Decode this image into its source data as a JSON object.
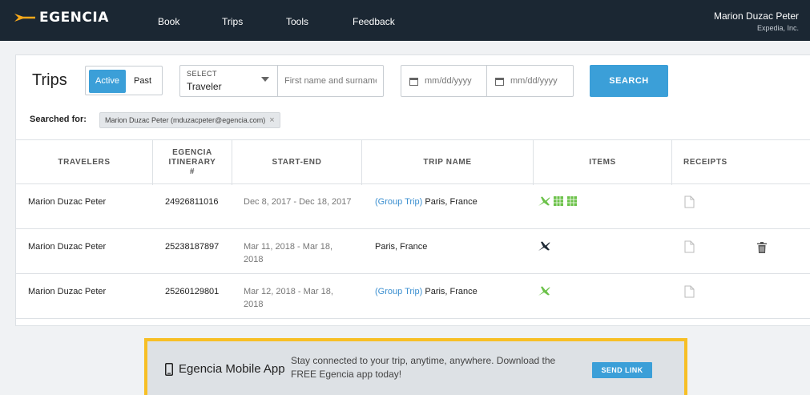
{
  "header": {
    "logo_text": "EGENCIA",
    "nav": [
      "Book",
      "Trips",
      "Tools",
      "Feedback"
    ],
    "user_name": "Marion Duzac Peter",
    "user_company": "Expedia, Inc."
  },
  "trips": {
    "title": "Trips",
    "toggle_active": "Active",
    "toggle_past": "Past",
    "select_label": "SELECT",
    "select_value": "Traveler",
    "name_placeholder": "First name and surname",
    "date_from_placeholder": "mm/dd/yyyy",
    "date_to_placeholder": "mm/dd/yyyy",
    "search_label": "SEARCH",
    "searched_for_label": "Searched for:",
    "searched_chip": "Marion Duzac Peter (mduzacpeter@egencia.com)",
    "chip_close": "×"
  },
  "table": {
    "headers": [
      "TRAVELERS",
      "EGENCIA ITINERARY #",
      "START-END",
      "TRIP NAME",
      "ITEMS",
      "RECEIPTS"
    ],
    "rows": [
      {
        "traveler": "Marion Duzac Peter",
        "itinerary": "24926811016",
        "dates": "Dec 8, 2017 - Dec 18, 2017",
        "group_prefix": "(Group Trip)",
        "trip_name": "Paris, France",
        "items": [
          "plane-green",
          "hotel-green",
          "hotel-green"
        ]
      },
      {
        "traveler": "Marion Duzac Peter",
        "itinerary": "25238187897",
        "dates": "Mar 11, 2018 - Mar 18, 2018",
        "group_prefix": "",
        "trip_name": "Paris, France",
        "items": [
          "plane-dark"
        ]
      },
      {
        "traveler": "Marion Duzac Peter",
        "itinerary": "25260129801",
        "dates": "Mar 12, 2018 - Mar 18, 2018",
        "group_prefix": "(Group Trip)",
        "trip_name": "Paris, France",
        "items": [
          "plane-green"
        ]
      }
    ]
  },
  "banner": {
    "app_name": "Egencia Mobile App",
    "message": "Stay connected to your trip, anytime, anywhere. Download the FREE Egencia app today!",
    "send_link": "SEND LINK"
  },
  "colors": {
    "topbar": "#1b2733",
    "accent_blue": "#3b9fd8",
    "item_green": "#6cc24a",
    "banner_border": "#f7bf25"
  }
}
